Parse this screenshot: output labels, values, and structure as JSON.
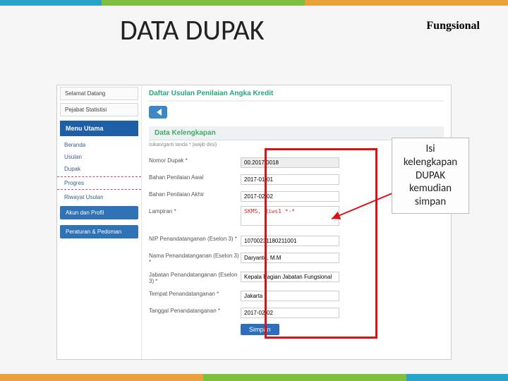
{
  "stripes": {
    "c1": "#2aa3c9",
    "c2": "#7fbf3f",
    "c3": "#e9a23b",
    "w1": "20%",
    "w2": "40%",
    "w3": "40%",
    "bw1": "40%",
    "bw2": "40%",
    "bw3": "20%"
  },
  "header": {
    "title": "DATA DUPAK",
    "tag": "Fungsional"
  },
  "sidebar": {
    "top1": "Selamat Datang",
    "top2": "Pejabat Statistisi",
    "menu_header": "Menu Utama",
    "items": [
      "Beranda",
      "Usulan",
      "Dupak",
      "Progres",
      "Riwayat Usulan"
    ],
    "block1": "Akun dan Profil",
    "block2": "Peraturan & Pedoman"
  },
  "main": {
    "crumb": "Daftar Usulan Penilaian Angka Kredit",
    "panel_title": "Data Kelengkapan",
    "hint": "Isikan/ganti tanda * (wajib diisi)",
    "fields": {
      "nomor": {
        "label": "Nomor Dupak *",
        "value": "00.2017.0018"
      },
      "awal": {
        "label": "Bahan Penilaian Awal",
        "value": "2017-01-01"
      },
      "akhir": {
        "label": "Bahan Penilaian Akhir",
        "value": "2017-02-02"
      },
      "lampiran": {
        "label": "Lampiran *",
        "value": "SKMS, Riws1 *-*"
      },
      "nip": {
        "label": "NIP Penandatanganan (Eselon 3) *",
        "value": "10700231180211001"
      },
      "nama": {
        "label": "Nama Penandatanganan (Eselon 3) *",
        "value": "Daryanto, M.M"
      },
      "jabatan": {
        "label": "Jabatan Penandatanganan (Eselon 3) *",
        "value": "Kepala Bagian Jabatan Fungsional"
      },
      "tempat": {
        "label": "Tempat Penandatanganan *",
        "value": "Jakarta"
      },
      "tanggal": {
        "label": "Tanggal Penandatanganan *",
        "value": "2017-02-02"
      }
    },
    "save": "Simpan"
  },
  "callout": {
    "l1": "Isi",
    "l2": "kelengkapan",
    "l3": "DUPAK",
    "l4": "kemudian",
    "l5": "simpan"
  }
}
